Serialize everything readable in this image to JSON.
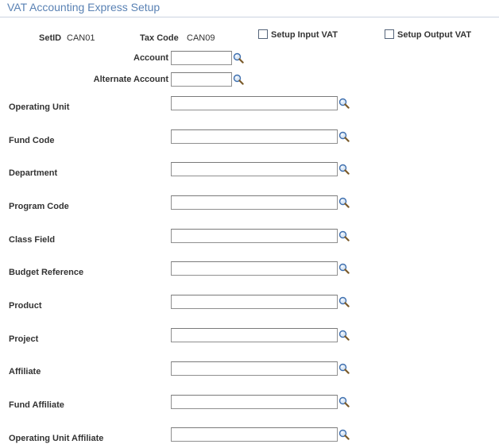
{
  "page": {
    "title": "VAT Accounting Express Setup"
  },
  "header": {
    "setid_label": "SetID",
    "setid_value": "CAN01",
    "taxcode_label": "Tax Code",
    "taxcode_value": "CAN09",
    "setup_input_vat_label": "Setup Input VAT",
    "setup_input_vat_checked": false,
    "setup_output_vat_label": "Setup Output VAT",
    "setup_output_vat_checked": false
  },
  "account": {
    "label": "Account",
    "value": ""
  },
  "alternate_account": {
    "label": "Alternate Account",
    "value": ""
  },
  "fields": [
    {
      "label": "Operating Unit",
      "value": ""
    },
    {
      "label": "Fund Code",
      "value": ""
    },
    {
      "label": "Department",
      "value": ""
    },
    {
      "label": "Program Code",
      "value": ""
    },
    {
      "label": "Class Field",
      "value": ""
    },
    {
      "label": "Budget Reference",
      "value": ""
    },
    {
      "label": "Product",
      "value": ""
    },
    {
      "label": "Project",
      "value": ""
    },
    {
      "label": "Affiliate",
      "value": ""
    },
    {
      "label": "Fund Affiliate",
      "value": ""
    },
    {
      "label": "Operating Unit Affiliate",
      "value": ""
    }
  ],
  "icons": {
    "lookup": "magnifier-icon",
    "checkbox": "checkbox-icon"
  },
  "colors": {
    "title": "#5a82b4",
    "rule": "#cbd4e0",
    "label": "#333333",
    "input_border": "#8f8f8f"
  }
}
